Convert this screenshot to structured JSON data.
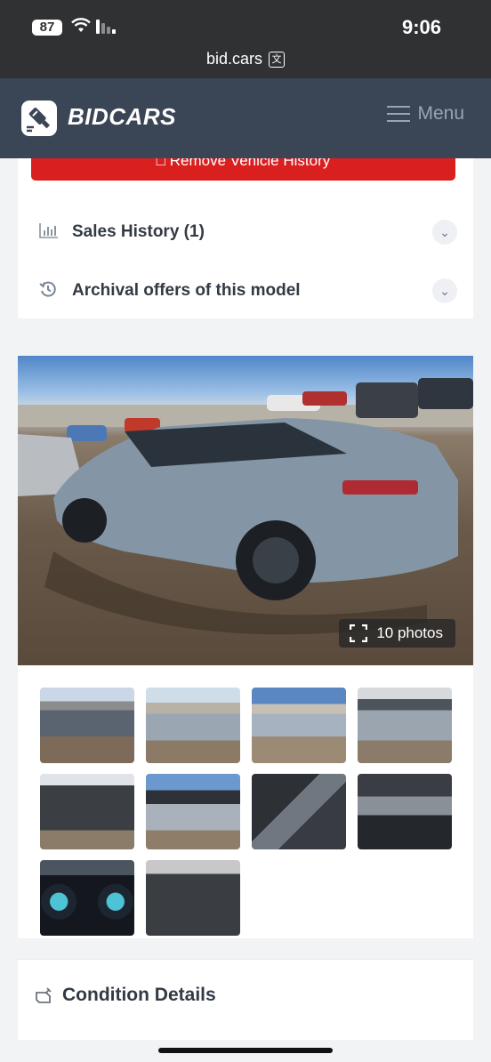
{
  "status_bar": {
    "battery": "87",
    "time": "9:06"
  },
  "browser": {
    "url": "bid.cars"
  },
  "header": {
    "logo_text": "BIDCARS",
    "menu_label": "Menu"
  },
  "remove_history_label": "Remove Vehicle History",
  "accordion": [
    {
      "icon": "bar-chart-icon",
      "label": "Sales History (1)"
    },
    {
      "icon": "history-icon",
      "label": "Archival offers of this model"
    }
  ],
  "gallery": {
    "photo_count_label": "10 photos",
    "thumbnail_count": 10
  },
  "condition": {
    "label": "Condition Details",
    "icon": "engine-icon"
  },
  "colors": {
    "header_bg": "#3a4555",
    "danger": "#d9201f",
    "page_bg": "#f2f3f5"
  }
}
